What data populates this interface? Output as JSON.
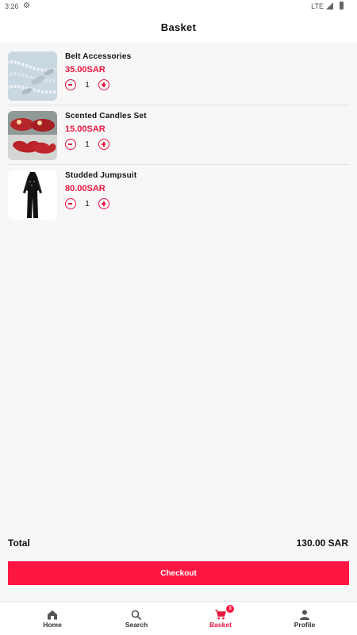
{
  "status_bar": {
    "time": "3:26",
    "network": "LTE"
  },
  "header": {
    "title": "Basket"
  },
  "basket": {
    "items": [
      {
        "name": "Belt Accessories",
        "price": "35.00SAR",
        "quantity": "1"
      },
      {
        "name": "Scented Candles Set",
        "price": "15.00SAR",
        "quantity": "1"
      },
      {
        "name": "Studded Jumpsuit",
        "price": "80.00SAR",
        "quantity": "1"
      }
    ]
  },
  "summary": {
    "total_label": "Total",
    "total_value": "130.00 SAR"
  },
  "checkout_label": "Checkout",
  "nav": {
    "items": [
      {
        "label": "Home",
        "icon": "home-icon"
      },
      {
        "label": "Search",
        "icon": "search-icon"
      },
      {
        "label": "Basket",
        "icon": "cart-icon",
        "badge": "3",
        "active": true
      },
      {
        "label": "Profile",
        "icon": "person-icon"
      }
    ]
  },
  "colors": {
    "accent": "#ff1744",
    "price": "#e8173f"
  }
}
